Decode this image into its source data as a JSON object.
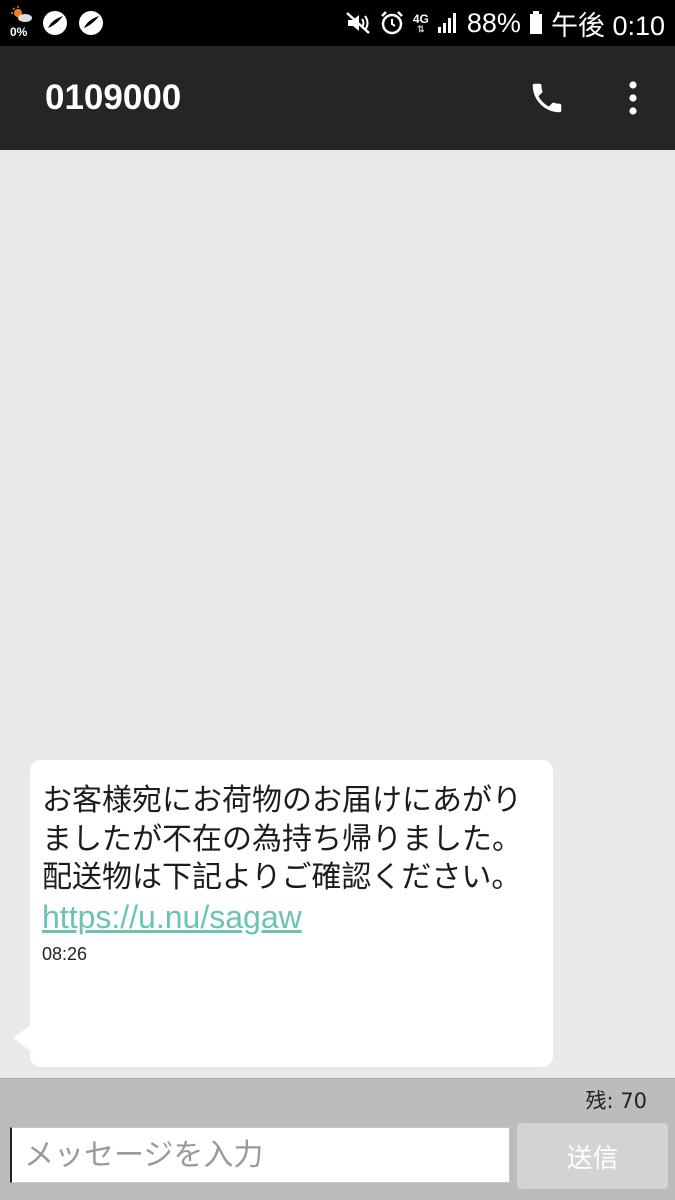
{
  "status_bar": {
    "weather_percent": "0%",
    "network_type": "4G",
    "battery_percent": "88%",
    "time": "午後 0:10",
    "icons": [
      "weather-icon",
      "app-icon",
      "app-icon",
      "mute-icon",
      "alarm-icon",
      "signal-icon",
      "battery-icon"
    ]
  },
  "header": {
    "title": "0109000",
    "call_icon": "phone-icon",
    "menu_icon": "more-vert-icon"
  },
  "message": {
    "text": "お客様宛にお荷物のお届けにあがりましたが不在の為持ち帰りました。\n配送物は下記よりご確認ください。",
    "link": "https://u.nu/sagaw",
    "time": "08:26"
  },
  "composer": {
    "remaining": "残: 70",
    "placeholder": "メッセージを入力",
    "value": "",
    "send_label": "送信"
  },
  "colors": {
    "status_bar": "#000000",
    "header": "#252525",
    "background": "#e9e9e9",
    "link": "#6ac3b5",
    "send_disabled": "#d3d3d3"
  }
}
